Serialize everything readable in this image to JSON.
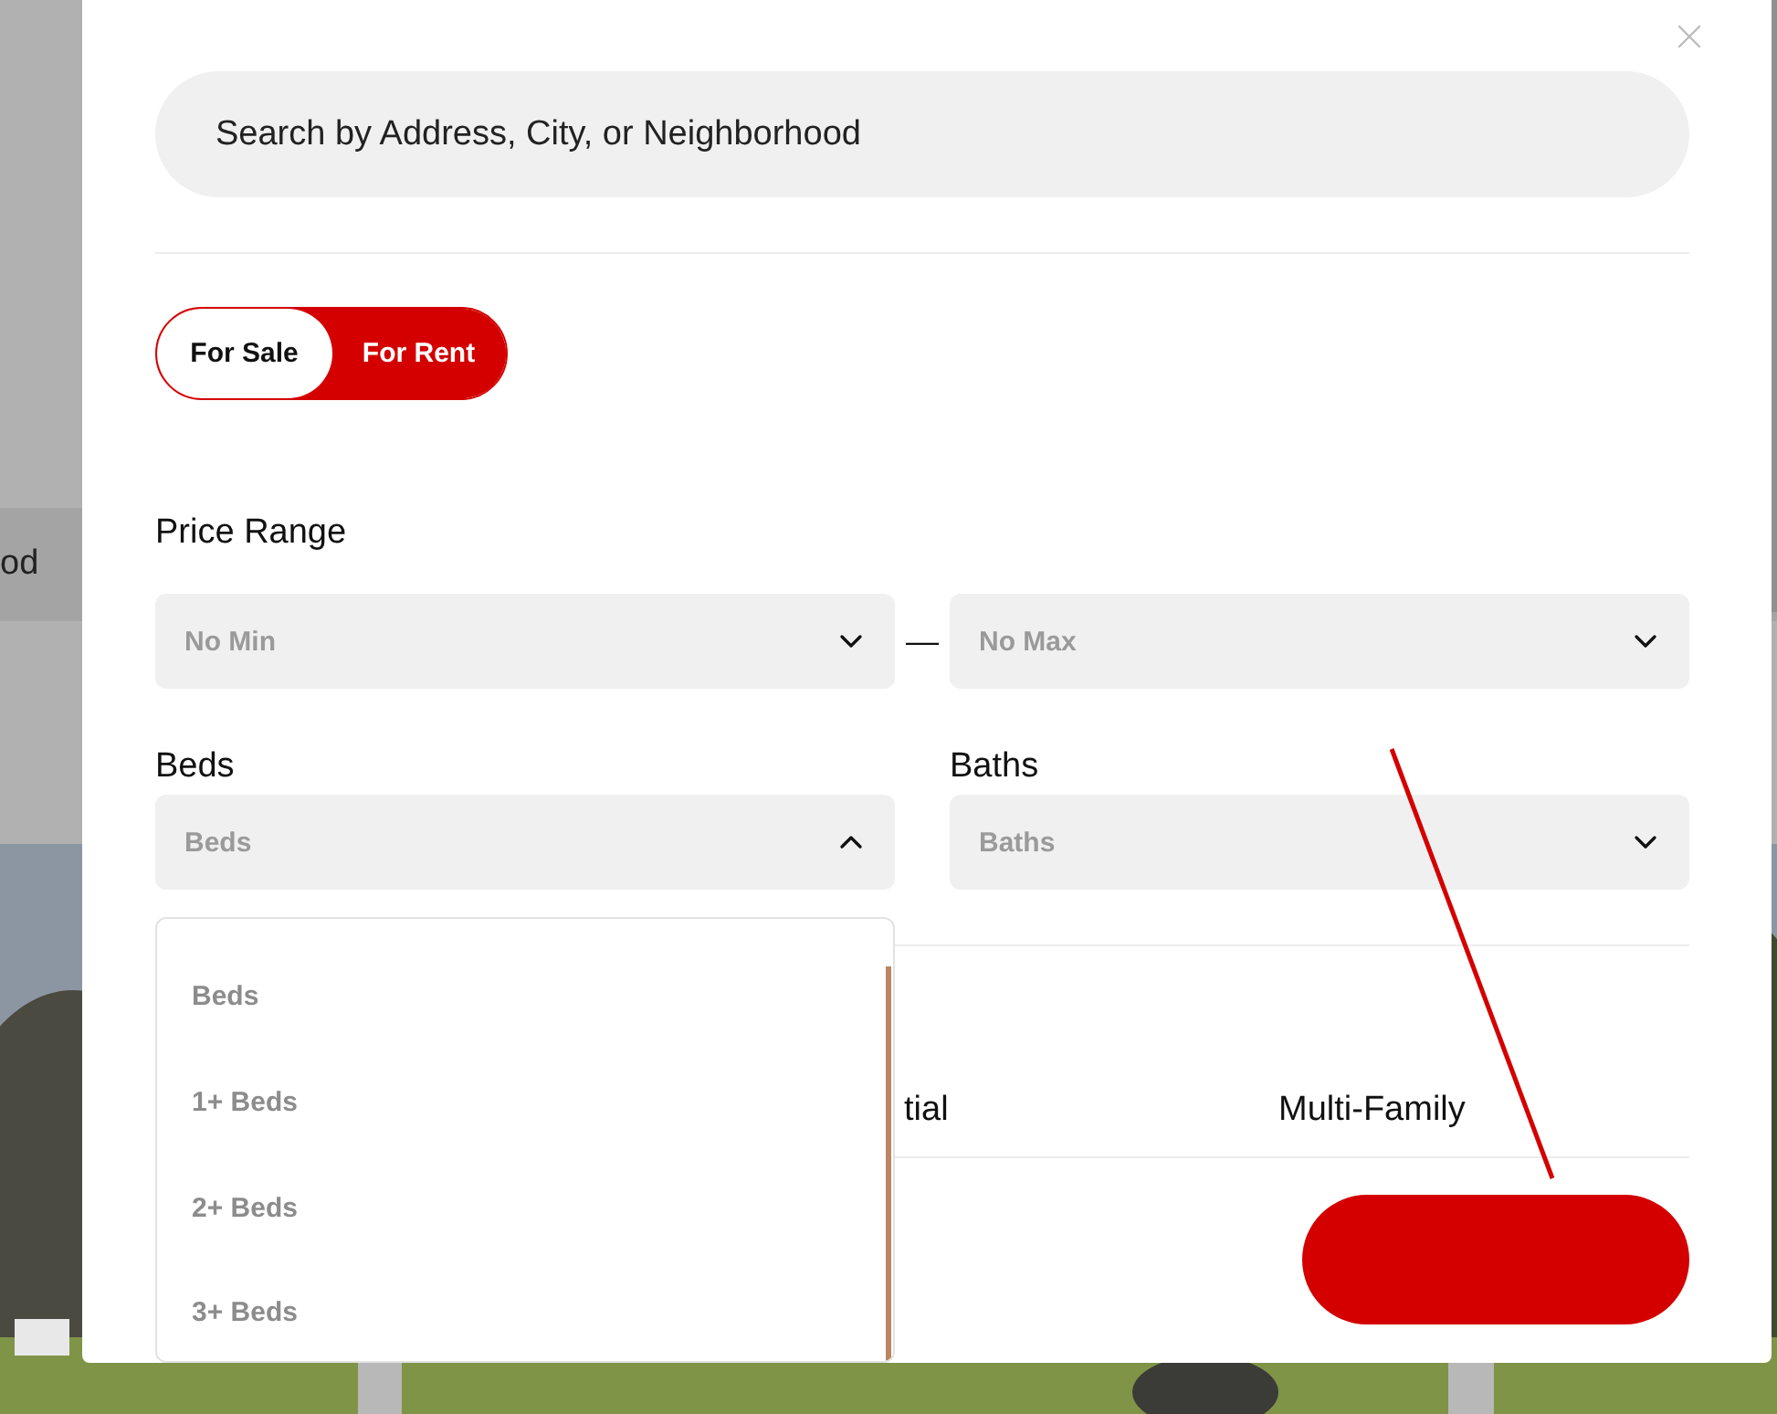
{
  "background": {
    "banner_text": "od"
  },
  "modal": {
    "search": {
      "placeholder": "Search by Address, City, or Neighborhood"
    },
    "listing_type": [
      {
        "label": "For Sale",
        "selected": false
      },
      {
        "label": "For Rent",
        "selected": true
      }
    ],
    "price_range": {
      "label": "Price Range",
      "separator": "—",
      "min": {
        "value": "No Min",
        "expanded": false
      },
      "max": {
        "value": "No Max",
        "expanded": false
      }
    },
    "beds": {
      "label": "Beds",
      "value": "Beds",
      "expanded": true,
      "options": [
        "Beds",
        "1+ Beds",
        "2+ Beds",
        "3+ Beds"
      ]
    },
    "baths": {
      "label": "Baths",
      "value": "Baths",
      "expanded": false
    },
    "property_types": [
      "tial",
      "Multi-Family"
    ]
  }
}
